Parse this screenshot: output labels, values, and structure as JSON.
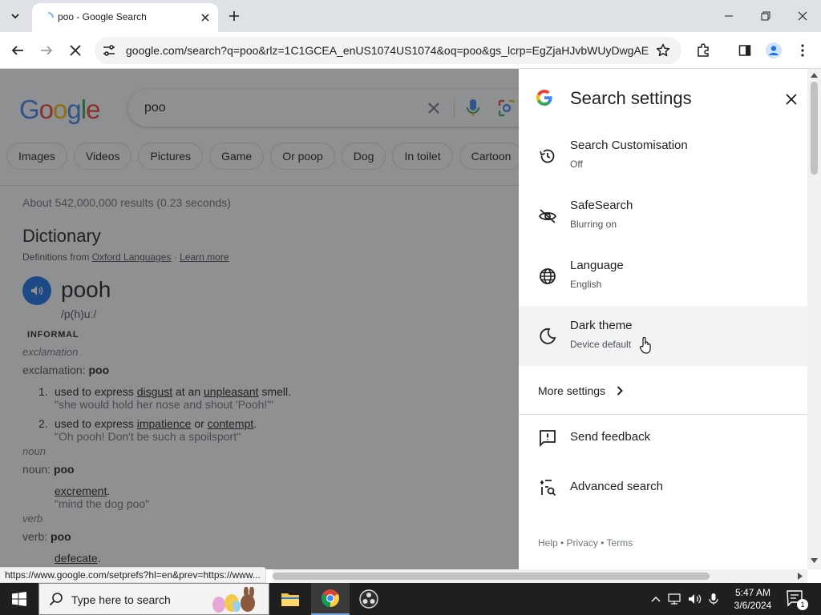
{
  "browser": {
    "tab_title": "poo - Google Search",
    "url": "google.com/search?q=poo&rlz=1C1GCEA_enUS1074US1074&oq=poo&gs_lcrp=EgZjaHJvbWUyDwgAE..."
  },
  "search": {
    "logo": "Google",
    "query": "poo",
    "chips": [
      "Images",
      "Videos",
      "Pictures",
      "Game",
      "Or poop",
      "Dog",
      "In toilet",
      "Cartoon"
    ],
    "result_stats": "About 542,000,000 results (0.23 seconds)"
  },
  "dictionary": {
    "title": "Dictionary",
    "source_prefix": "Definitions from ",
    "source_name": "Oxford Languages",
    "source_sep": " · ",
    "learn_more": "Learn more",
    "headword": "pooh",
    "pronunciation": "/p(h)uː/",
    "register": "INFORMAL",
    "pos1": "exclamation",
    "pos1_line_label": "exclamation: ",
    "pos1_line_word": "poo",
    "def1_num": "1.",
    "def1_pre": "used to express ",
    "def1_link1": "disgust",
    "def1_mid": " at an ",
    "def1_link2": "unpleasant",
    "def1_post": " smell.",
    "def1_example": "\"she would hold her nose and shout 'Pooh!'\"",
    "def2_num": "2.",
    "def2_pre": "used to express ",
    "def2_link1": "impatience",
    "def2_mid": " or ",
    "def2_link2": "contempt",
    "def2_post": ".",
    "def2_example": "\"Oh pooh! Don't be such a spoilsport\"",
    "pos2": "noun",
    "pos2_line_label": "noun: ",
    "pos2_line_word": "poo",
    "noun_def": "excrement",
    "noun_def_post": ".",
    "noun_example": "\"mind the dog poo\"",
    "pos3": "verb",
    "pos3_line_label": "verb: ",
    "pos3_line_word": "poo",
    "verb_def": "defecate",
    "verb_def_post": "."
  },
  "settings": {
    "title": "Search settings",
    "items": [
      {
        "label": "Search Customisation",
        "sub": "Off",
        "icon": "history-icon"
      },
      {
        "label": "SafeSearch",
        "sub": "Blurring on",
        "icon": "eye-off-icon"
      },
      {
        "label": "Language",
        "sub": "English",
        "icon": "globe-icon"
      },
      {
        "label": "Dark theme",
        "sub": "Device default",
        "icon": "moon-icon"
      }
    ],
    "more_settings": "More settings",
    "send_feedback": "Send feedback",
    "advanced_search": "Advanced search",
    "footer": "Help • Privacy • Terms"
  },
  "status_url": "https://www.google.com/setprefs?hl=en&prev=https://www...",
  "taskbar": {
    "search_placeholder": "Type here to search",
    "time": "5:47 AM",
    "date": "3/6/2024",
    "notification_count": "1"
  },
  "colors": {
    "accent": "#1a73e8",
    "google_blue": "#4285F4",
    "google_red": "#EA4335",
    "google_yellow": "#FBBC05",
    "google_green": "#34A853"
  }
}
